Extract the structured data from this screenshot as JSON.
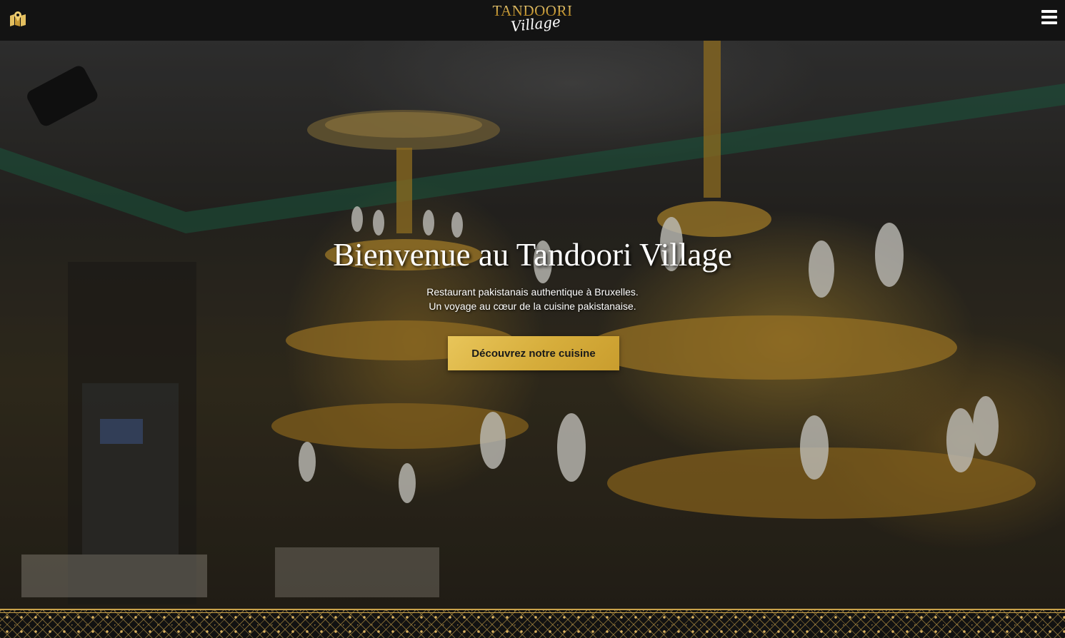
{
  "header": {
    "logo": {
      "line1": "TANDOORI",
      "line2": "Village"
    },
    "map_icon": "map-marker-icon",
    "menu_icon": "hamburger-menu-icon"
  },
  "hero": {
    "title": "Bienvenue au Tandoori Village",
    "subtitle_line1": "Restaurant pakistanais authentique à Bruxelles.",
    "subtitle_line2": "Un voyage au cœur de la cuisine pakistanaise.",
    "cta_label": "Découvrez notre cuisine"
  },
  "colors": {
    "header_bg": "#131313",
    "gold_accent": "#d6ad3b",
    "cta_text": "#1a1a1a",
    "hero_text": "#ffffff"
  }
}
